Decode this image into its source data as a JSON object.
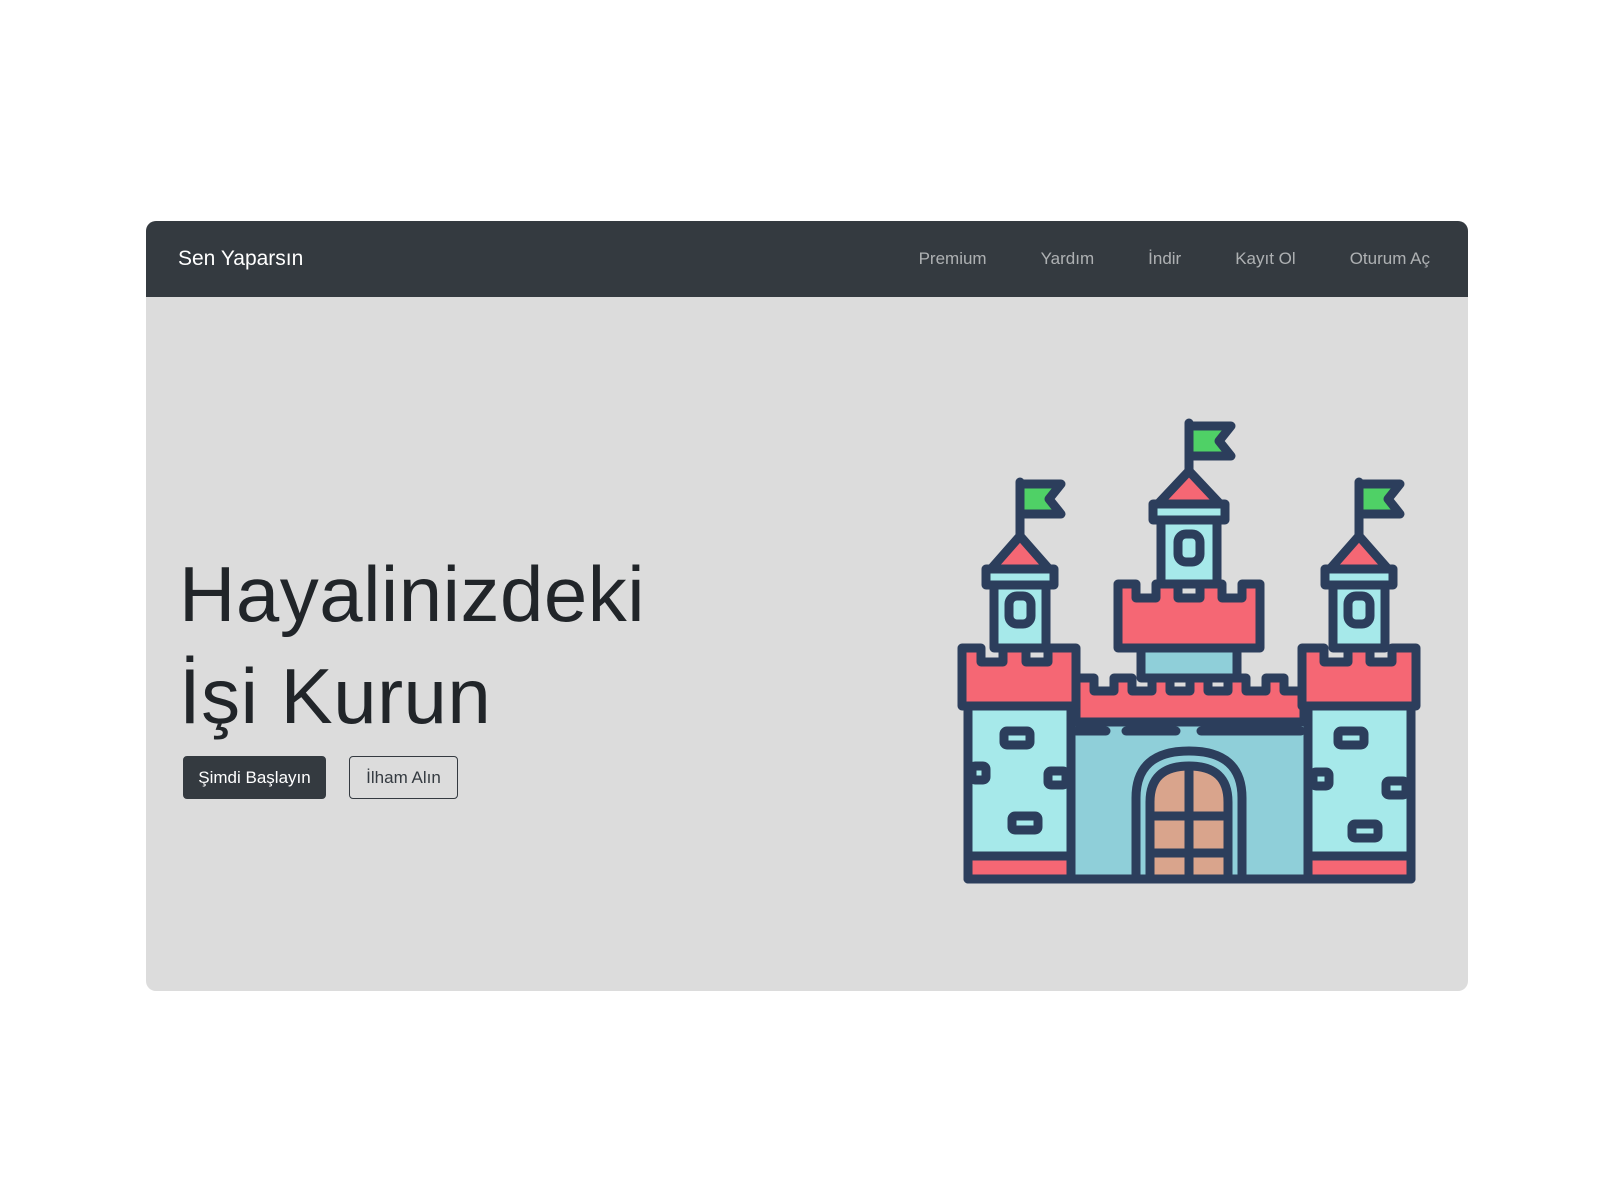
{
  "navbar": {
    "brand": "Sen Yaparsın",
    "links": [
      "Premium",
      "Yardım",
      "İndir",
      "Kayıt Ol",
      "Oturum Aç"
    ]
  },
  "hero": {
    "title_line1": "Hayalinizdeki",
    "title_line2": "İşi Kurun",
    "primary_button": "Şimdi Başlayın",
    "secondary_button": "İlham Alın"
  },
  "illustration": {
    "icon": "castle-icon"
  },
  "colors": {
    "navbar_bg": "#343a40",
    "hero_bg": "#dcdcdc",
    "castle_red": "#f56774",
    "castle_teal": "#8fd3dd",
    "castle_outline": "#2c3e5c",
    "flag_green": "#4fd166"
  }
}
